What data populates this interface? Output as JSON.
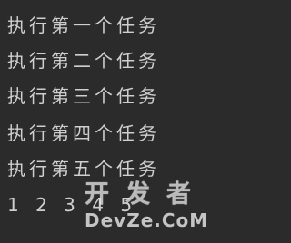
{
  "console": {
    "lines": [
      "执行第一个任务",
      "执行第二个任务",
      "执行第三个任务",
      "执行第四个任务",
      "执行第五个任务"
    ],
    "number_line": "1 2 3 4 5"
  },
  "watermark": {
    "top": "开发者",
    "bottom": "DevZe.CoM"
  }
}
